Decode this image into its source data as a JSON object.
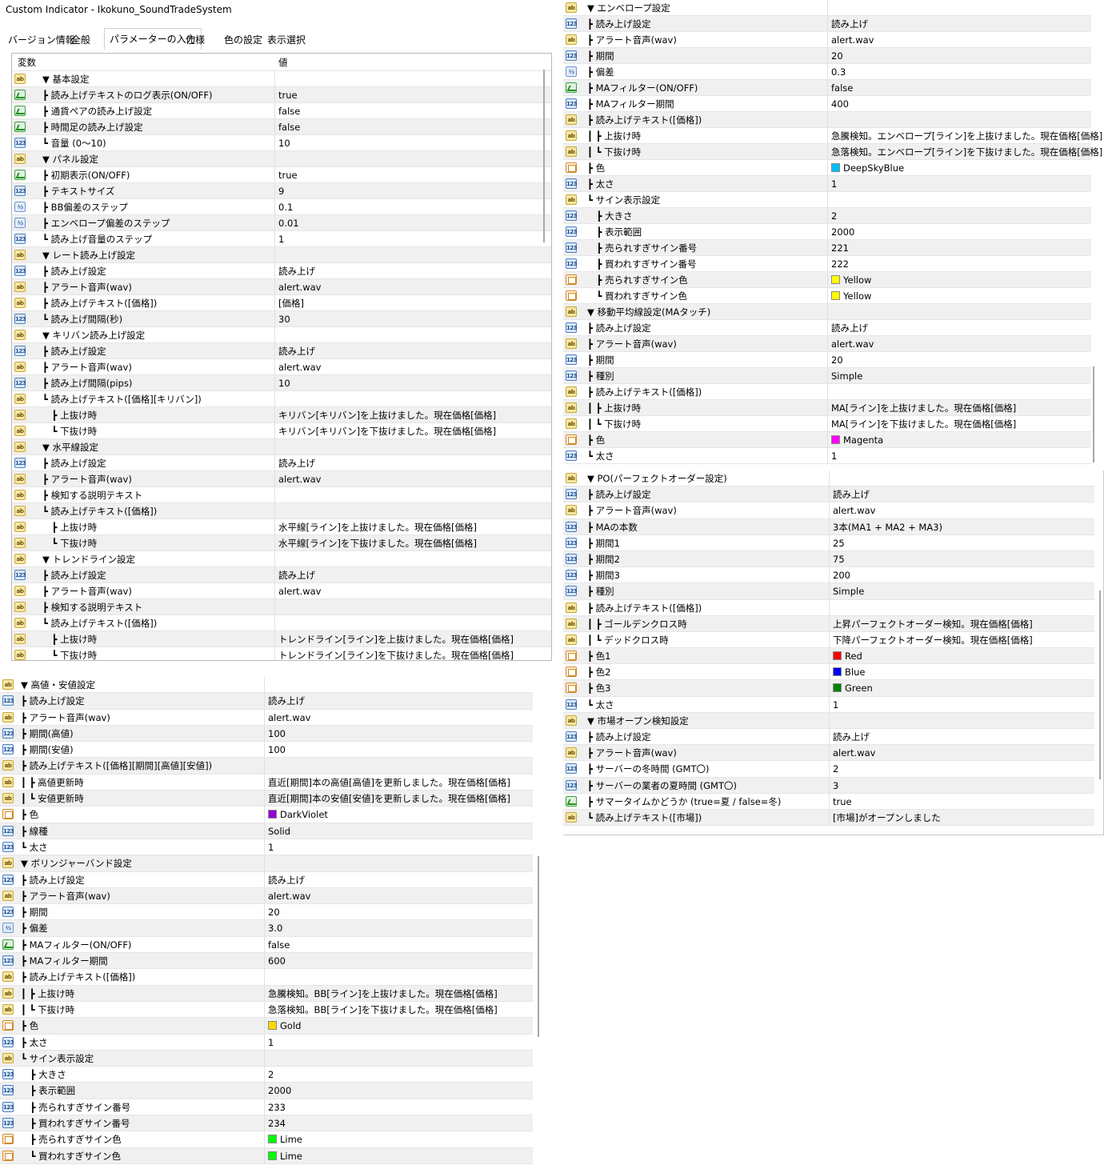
{
  "window": {
    "title": "Custom Indicator - Ikokuno_SoundTradeSystem",
    "tabs": [
      "バージョン情報",
      "全般",
      "パラメーターの入力",
      "仕様",
      "色の設定",
      "表示選択"
    ],
    "active_tab": "パラメーターの入力",
    "col_var": "変数",
    "col_val": "値"
  },
  "panel1_rows": [
    {
      "t": "ab",
      "n": "▼ 基本設定",
      "v": ""
    },
    {
      "t": "tf",
      "n": "┣ 読み上げテキストのログ表示(ON/OFF)",
      "v": "true"
    },
    {
      "t": "tf",
      "n": "┣ 通貨ペアの読み上げ設定",
      "v": "false"
    },
    {
      "t": "tf",
      "n": "┣ 時間足の読み上げ設定",
      "v": "false"
    },
    {
      "t": "n123",
      "n": "┗ 音量 (0〜10)",
      "v": "10"
    },
    {
      "t": "ab",
      "n": "▼ パネル設定",
      "v": ""
    },
    {
      "t": "tf",
      "n": "┣ 初期表示(ON/OFF)",
      "v": "true"
    },
    {
      "t": "n123",
      "n": "┣ テキストサイズ",
      "v": "9"
    },
    {
      "t": "v2",
      "n": "┣ BB偏差のステップ",
      "v": "0.1"
    },
    {
      "t": "v2",
      "n": "┣ エンベロープ偏差のステップ",
      "v": "0.01"
    },
    {
      "t": "n123",
      "n": "┗ 読み上げ音量のステップ",
      "v": "1"
    },
    {
      "t": "ab",
      "n": "▼ レート読み上げ設定",
      "v": ""
    },
    {
      "t": "n123",
      "n": "┣ 読み上げ設定",
      "v": "読み上げ"
    },
    {
      "t": "ab",
      "n": "┣ アラート音声(wav)",
      "v": "alert.wav"
    },
    {
      "t": "ab",
      "n": "┣ 読み上げテキスト([価格])",
      "v": "[価格]"
    },
    {
      "t": "n123",
      "n": "┗ 読み上げ間隔(秒)",
      "v": "30"
    },
    {
      "t": "ab",
      "n": "▼ キリバン読み上げ設定",
      "v": ""
    },
    {
      "t": "n123",
      "n": "┣ 読み上げ設定",
      "v": "読み上げ"
    },
    {
      "t": "ab",
      "n": "┣ アラート音声(wav)",
      "v": "alert.wav"
    },
    {
      "t": "n123",
      "n": "┣ 読み上げ間隔(pips)",
      "v": "10"
    },
    {
      "t": "ab",
      "n": "┗ 読み上げテキスト([価格][キリバン])",
      "v": ""
    },
    {
      "t": "ab",
      "n": "　┣ 上抜け時",
      "v": "キリバン[キリバン]を上抜けました。現在価格[価格]"
    },
    {
      "t": "ab",
      "n": "　┗ 下抜け時",
      "v": "キリバン[キリバン]を下抜けました。現在価格[価格]"
    },
    {
      "t": "ab",
      "n": "▼ 水平線設定",
      "v": ""
    },
    {
      "t": "n123",
      "n": "┣ 読み上げ設定",
      "v": "読み上げ"
    },
    {
      "t": "ab",
      "n": "┣ アラート音声(wav)",
      "v": "alert.wav"
    },
    {
      "t": "ab",
      "n": "┣ 検知する説明テキスト",
      "v": ""
    },
    {
      "t": "ab",
      "n": "┗ 読み上げテキスト([価格])",
      "v": ""
    },
    {
      "t": "ab",
      "n": "　┣ 上抜け時",
      "v": "水平線[ライン]を上抜けました。現在価格[価格]"
    },
    {
      "t": "ab",
      "n": "　┗ 下抜け時",
      "v": "水平線[ライン]を下抜けました。現在価格[価格]"
    },
    {
      "t": "ab",
      "n": "▼ トレンドライン設定",
      "v": ""
    },
    {
      "t": "n123",
      "n": "┣ 読み上げ設定",
      "v": "読み上げ"
    },
    {
      "t": "ab",
      "n": "┣ アラート音声(wav)",
      "v": "alert.wav"
    },
    {
      "t": "ab",
      "n": "┣ 検知する説明テキスト",
      "v": ""
    },
    {
      "t": "ab",
      "n": "┗ 読み上げテキスト([価格])",
      "v": ""
    },
    {
      "t": "ab",
      "n": "　┣ 上抜け時",
      "v": "トレンドライン[ライン]を上抜けました。現在価格[価格]"
    },
    {
      "t": "ab",
      "n": "　┗ 下抜け時",
      "v": "トレンドライン[ライン]を下抜けました。現在価格[価格]"
    }
  ],
  "panel2_rows": [
    {
      "t": "ab",
      "n": "▼ エンベロープ設定",
      "v": ""
    },
    {
      "t": "n123",
      "n": "┣ 読み上げ設定",
      "v": "読み上げ"
    },
    {
      "t": "ab",
      "n": "┣ アラート音声(wav)",
      "v": "alert.wav"
    },
    {
      "t": "n123",
      "n": "┣ 期間",
      "v": "20"
    },
    {
      "t": "v2",
      "n": "┣ 偏差",
      "v": "0.3"
    },
    {
      "t": "tf",
      "n": "┣ MAフィルター(ON/OFF)",
      "v": "false"
    },
    {
      "t": "n123",
      "n": "┣ MAフィルター期間",
      "v": "400"
    },
    {
      "t": "ab",
      "n": "┣ 読み上げテキスト([価格])",
      "v": ""
    },
    {
      "t": "ab",
      "n": "┃ ┣ 上抜け時",
      "v": "急騰検知。エンベロープ[ライン]を上抜けました。現在価格[価格]"
    },
    {
      "t": "ab",
      "n": "┃ ┗ 下抜け時",
      "v": "急落検知。エンベロープ[ライン]を下抜けました。現在価格[価格]"
    },
    {
      "t": "clr",
      "n": "┣ 色",
      "v": "DeepSkyBlue",
      "c": "#00BFFF"
    },
    {
      "t": "n123",
      "n": "┣ 太さ",
      "v": "1"
    },
    {
      "t": "ab",
      "n": "┗ サイン表示設定",
      "v": ""
    },
    {
      "t": "n123",
      "n": "　┣ 大きさ",
      "v": "2"
    },
    {
      "t": "n123",
      "n": "　┣ 表示範囲",
      "v": "2000"
    },
    {
      "t": "n123",
      "n": "　┣ 売られすぎサイン番号",
      "v": "221"
    },
    {
      "t": "n123",
      "n": "　┣ 買われすぎサイン番号",
      "v": "222"
    },
    {
      "t": "clr",
      "n": "　┣ 売られすぎサイン色",
      "v": "Yellow",
      "c": "#FFFF00"
    },
    {
      "t": "clr",
      "n": "　┗ 買われすぎサイン色",
      "v": "Yellow",
      "c": "#FFFF00"
    },
    {
      "t": "ab",
      "n": "▼ 移動平均線設定(MAタッチ)",
      "v": ""
    },
    {
      "t": "n123",
      "n": "┣ 読み上げ設定",
      "v": "読み上げ"
    },
    {
      "t": "ab",
      "n": "┣ アラート音声(wav)",
      "v": "alert.wav"
    },
    {
      "t": "n123",
      "n": "┣ 期間",
      "v": "20"
    },
    {
      "t": "n123",
      "n": "┣ 種別",
      "v": "Simple"
    },
    {
      "t": "ab",
      "n": "┣ 読み上げテキスト([価格])",
      "v": ""
    },
    {
      "t": "ab",
      "n": "┃ ┣ 上抜け時",
      "v": "MA[ライン]を上抜けました。現在価格[価格]"
    },
    {
      "t": "ab",
      "n": "┃ ┗ 下抜け時",
      "v": "MA[ライン]を下抜けました。現在価格[価格]"
    },
    {
      "t": "clr",
      "n": "┣ 色",
      "v": "Magenta",
      "c": "#FF00FF"
    },
    {
      "t": "n123",
      "n": "┗ 太さ",
      "v": "1"
    }
  ],
  "panel3_rows": [
    {
      "t": "ab",
      "n": "▼ PO(パーフェクトオーダー設定)",
      "v": ""
    },
    {
      "t": "n123",
      "n": "┣ 読み上げ設定",
      "v": "読み上げ"
    },
    {
      "t": "ab",
      "n": "┣ アラート音声(wav)",
      "v": "alert.wav"
    },
    {
      "t": "n123",
      "n": "┣ MAの本数",
      "v": "3本(MA1 + MA2 + MA3)"
    },
    {
      "t": "n123",
      "n": "┣ 期間1",
      "v": "25"
    },
    {
      "t": "n123",
      "n": "┣ 期間2",
      "v": "75"
    },
    {
      "t": "n123",
      "n": "┣ 期間3",
      "v": "200"
    },
    {
      "t": "n123",
      "n": "┣ 種別",
      "v": "Simple"
    },
    {
      "t": "ab",
      "n": "┣ 読み上げテキスト([価格])",
      "v": ""
    },
    {
      "t": "ab",
      "n": "┃ ┣ ゴールデンクロス時",
      "v": "上昇パーフェクトオーダー検知。現在価格[価格]"
    },
    {
      "t": "ab",
      "n": "┃ ┗ デッドクロス時",
      "v": "下降パーフェクトオーダー検知。現在価格[価格]"
    },
    {
      "t": "clr",
      "n": "┣ 色1",
      "v": "Red",
      "c": "#FF0000"
    },
    {
      "t": "clr",
      "n": "┣ 色2",
      "v": "Blue",
      "c": "#0000FF"
    },
    {
      "t": "clr",
      "n": "┣ 色3",
      "v": "Green",
      "c": "#008000"
    },
    {
      "t": "n123",
      "n": "┗ 太さ",
      "v": "1"
    },
    {
      "t": "ab",
      "n": "▼ 市場オープン検知設定",
      "v": ""
    },
    {
      "t": "n123",
      "n": "┣ 読み上げ設定",
      "v": "読み上げ"
    },
    {
      "t": "ab",
      "n": "┣ アラート音声(wav)",
      "v": "alert.wav"
    },
    {
      "t": "n123",
      "n": "┣ サーバーの冬時間 (GMT〇)",
      "v": "2"
    },
    {
      "t": "n123",
      "n": "┣ サーバーの業者の夏時間 (GMT〇)",
      "v": "3"
    },
    {
      "t": "tf",
      "n": "┣ サマータイムかどうか (true=夏 / false=冬)",
      "v": "true"
    },
    {
      "t": "ab",
      "n": "┗ 読み上げテキスト([市場])",
      "v": "[市場]がオープンしました"
    }
  ],
  "panel4_rows": [
    {
      "t": "ab",
      "n": "▼ 高値・安値設定",
      "v": ""
    },
    {
      "t": "n123",
      "n": "┣ 読み上げ設定",
      "v": "読み上げ"
    },
    {
      "t": "ab",
      "n": "┣ アラート音声(wav)",
      "v": "alert.wav"
    },
    {
      "t": "n123",
      "n": "┣ 期間(高値)",
      "v": "100"
    },
    {
      "t": "n123",
      "n": "┣ 期間(安値)",
      "v": "100"
    },
    {
      "t": "ab",
      "n": "┣ 読み上げテキスト([価格][期間][高値][安値])",
      "v": ""
    },
    {
      "t": "ab",
      "n": "┃ ┣ 高値更新時",
      "v": "直近[期間]本の高値[高値]を更新しました。現在価格[価格]"
    },
    {
      "t": "ab",
      "n": "┃ ┗ 安値更新時",
      "v": "直近[期間]本の安値[安値]を更新しました。現在価格[価格]"
    },
    {
      "t": "clr",
      "n": "┣ 色",
      "v": "DarkViolet",
      "c": "#9400D3"
    },
    {
      "t": "n123",
      "n": "┣ 線種",
      "v": "Solid"
    },
    {
      "t": "n123",
      "n": "┗ 太さ",
      "v": "1"
    },
    {
      "t": "ab",
      "n": "▼ ボリンジャーバンド設定",
      "v": ""
    },
    {
      "t": "n123",
      "n": "┣ 読み上げ設定",
      "v": "読み上げ"
    },
    {
      "t": "ab",
      "n": "┣ アラート音声(wav)",
      "v": "alert.wav"
    },
    {
      "t": "n123",
      "n": "┣ 期間",
      "v": "20"
    },
    {
      "t": "v2",
      "n": "┣ 偏差",
      "v": "3.0"
    },
    {
      "t": "tf",
      "n": "┣ MAフィルター(ON/OFF)",
      "v": "false"
    },
    {
      "t": "n123",
      "n": "┣ MAフィルター期間",
      "v": "600"
    },
    {
      "t": "ab",
      "n": "┣ 読み上げテキスト([価格])",
      "v": ""
    },
    {
      "t": "ab",
      "n": "┃ ┣ 上抜け時",
      "v": "急騰検知。BB[ライン]を上抜けました。現在価格[価格]"
    },
    {
      "t": "ab",
      "n": "┃ ┗ 下抜け時",
      "v": "急落検知。BB[ライン]を下抜けました。現在価格[価格]"
    },
    {
      "t": "clr",
      "n": "┣ 色",
      "v": "Gold",
      "c": "#FFD700"
    },
    {
      "t": "n123",
      "n": "┣ 太さ",
      "v": "1"
    },
    {
      "t": "ab",
      "n": "┗ サイン表示設定",
      "v": ""
    },
    {
      "t": "n123",
      "n": "　┣ 大きさ",
      "v": "2"
    },
    {
      "t": "n123",
      "n": "　┣ 表示範囲",
      "v": "2000"
    },
    {
      "t": "n123",
      "n": "　┣ 売られすぎサイン番号",
      "v": "233"
    },
    {
      "t": "n123",
      "n": "　┣ 買われすぎサイン番号",
      "v": "234"
    },
    {
      "t": "clr",
      "n": "　┣ 売られすぎサイン色",
      "v": "Lime",
      "c": "#00FF00"
    },
    {
      "t": "clr",
      "n": "　┗ 買われすぎサイン色",
      "v": "Lime",
      "c": "#00FF00"
    }
  ]
}
